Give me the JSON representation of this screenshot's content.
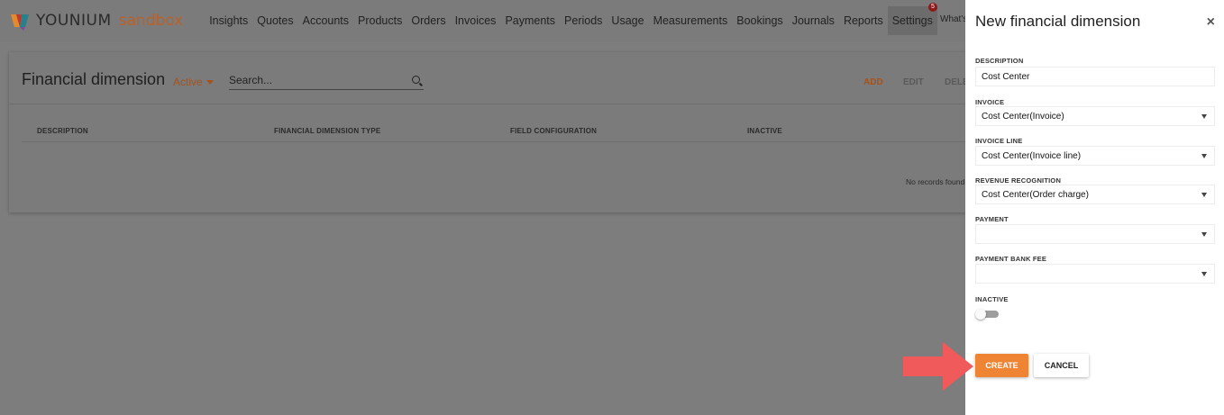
{
  "brand": {
    "name": "YOUNIUM",
    "environment": "sandbox",
    "colors": {
      "accent": "#ee8434",
      "logo_orange": "#e58a2c",
      "logo_red": "#c0392b",
      "logo_teal": "#2a7f8a",
      "logo_purple": "#7a4f8f"
    }
  },
  "nav": {
    "items": [
      {
        "label": "Insights"
      },
      {
        "label": "Quotes"
      },
      {
        "label": "Accounts"
      },
      {
        "label": "Products"
      },
      {
        "label": "Orders"
      },
      {
        "label": "Invoices"
      },
      {
        "label": "Payments"
      },
      {
        "label": "Periods"
      },
      {
        "label": "Usage"
      },
      {
        "label": "Measurements"
      },
      {
        "label": "Bookings"
      },
      {
        "label": "Journals"
      },
      {
        "label": "Reports"
      },
      {
        "label": "Settings"
      }
    ],
    "active": "Settings",
    "notification_count": "5",
    "whats_new": "What's new"
  },
  "main": {
    "title": "Financial dimension",
    "filter": "Active",
    "search": {
      "placeholder": "Search..."
    },
    "actions": {
      "add": "ADD",
      "edit": "EDIT",
      "delete": "DELETE"
    },
    "columns": [
      "DESCRIPTION",
      "FINANCIAL DIMENSION TYPE",
      "FIELD CONFIGURATION",
      "INACTIVE"
    ],
    "empty_text": "No records found"
  },
  "panel": {
    "title": "New financial dimension",
    "close_icon": "close-icon",
    "fields": {
      "description": {
        "label": "DESCRIPTION",
        "value": "Cost Center"
      },
      "invoice": {
        "label": "INVOICE",
        "value": "Cost Center(Invoice)"
      },
      "invoice_line": {
        "label": "INVOICE LINE",
        "value": "Cost Center(Invoice line)"
      },
      "revenue_recognition": {
        "label": "REVENUE RECOGNITION",
        "value": "Cost Center(Order charge)"
      },
      "payment": {
        "label": "PAYMENT",
        "value": ""
      },
      "payment_bank_fee": {
        "label": "PAYMENT BANK FEE",
        "value": ""
      },
      "inactive": {
        "label": "INACTIVE",
        "checked": false
      }
    },
    "buttons": {
      "create": "CREATE",
      "cancel": "CANCEL"
    }
  },
  "annotation": {
    "arrow_color": "#f05a5a",
    "points_to": "create-button"
  }
}
